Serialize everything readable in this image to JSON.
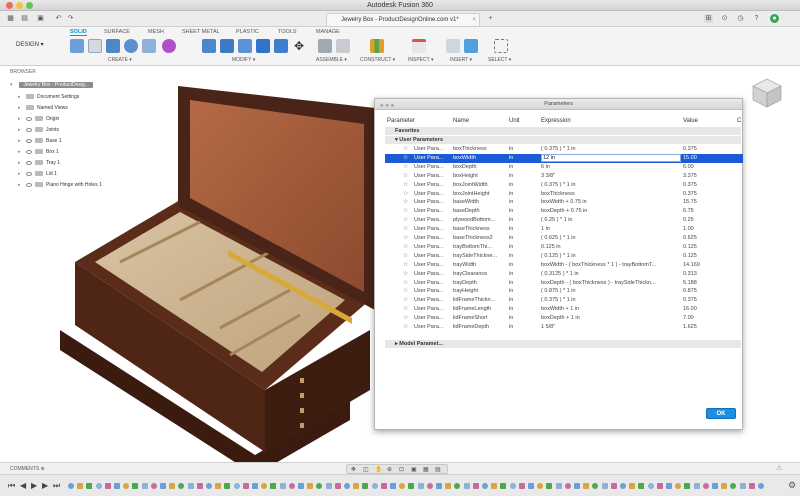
{
  "window": {
    "title": "Autodesk Fusion 360",
    "document_tab": "Jewelry Box - ProductDesignOnline.com v1*"
  },
  "ribbon": {
    "workspace": "DESIGN",
    "tabs": [
      "SOLID",
      "SURFACE",
      "MESH",
      "SHEET METAL",
      "PLASTIC",
      "TOOLS",
      "MANAGE"
    ],
    "active_tab": "SOLID",
    "groups": [
      "CREATE",
      "MODIFY",
      "ASSEMBLE",
      "CONSTRUCT",
      "INSPECT",
      "INSERT",
      "SELECT"
    ]
  },
  "browser": {
    "header": "BROWSER",
    "root": "Jewelry Box - ProductDesig...",
    "items": [
      "Document Settings",
      "Named Views",
      "Origin",
      "Joints",
      "Base 1",
      "Box 1",
      "Tray 1",
      "Lid 1",
      "Piano Hinge with Holes 1"
    ]
  },
  "dialog": {
    "title": "Parameters",
    "columns": [
      "Parameter",
      "Name",
      "Unit",
      "Expression",
      "Value",
      "C"
    ],
    "section_favorites": "Favorites",
    "section_user": "User Parameters",
    "section_model": "Model Paramet...",
    "param_type": "User Para...",
    "rows": [
      {
        "name": "boxThickness",
        "unit": "in",
        "expression": "( 0.375 ) * 1 in",
        "value": "0.375"
      },
      {
        "name": "boxWidth",
        "unit": "in",
        "expression": "12 in",
        "value": "15.00",
        "selected": true
      },
      {
        "name": "boxDepth",
        "unit": "in",
        "expression": "6 in",
        "value": "6.00"
      },
      {
        "name": "boxHeight",
        "unit": "in",
        "expression": "3 3/8\"",
        "value": "3.375"
      },
      {
        "name": "boxJointWidth",
        "unit": "in",
        "expression": "( 0.375 ) * 1 in",
        "value": "0.375"
      },
      {
        "name": "boxJointHeight",
        "unit": "in",
        "expression": "boxThickness",
        "value": "0.375"
      },
      {
        "name": "baseWidth",
        "unit": "in",
        "expression": "boxWidth + 0.75 in",
        "value": "15.75"
      },
      {
        "name": "baseDepth",
        "unit": "in",
        "expression": "boxDepth + 0.75 in",
        "value": "6.75"
      },
      {
        "name": "plywoodBottom...",
        "unit": "in",
        "expression": "( 0.25 ) * 1 in",
        "value": "0.25"
      },
      {
        "name": "baseThickness",
        "unit": "in",
        "expression": "1 in",
        "value": "1.00"
      },
      {
        "name": "baseThickness2",
        "unit": "in",
        "expression": "( 0.625 ) * 1 in",
        "value": "0.625"
      },
      {
        "name": "trayBottomThi...",
        "unit": "in",
        "expression": "0.125 in",
        "value": "0.125"
      },
      {
        "name": "traySideThickne...",
        "unit": "in",
        "expression": "( 0.125 ) * 1 in",
        "value": "0.125"
      },
      {
        "name": "trayWidth",
        "unit": "in",
        "expression": "boxWidth - ( boxThickness * 1 ) - trayBottomT...",
        "value": "14.169"
      },
      {
        "name": "trayClearance",
        "unit": "in",
        "expression": "( 0.3125 ) * 1 in",
        "value": "0.313"
      },
      {
        "name": "trayDepth",
        "unit": "in",
        "expression": "boxDepth - ( boxThickness ) - traySideThickn...",
        "value": "5.188"
      },
      {
        "name": "trayHeight",
        "unit": "in",
        "expression": "( 0.875 ) * 1 in",
        "value": "0.875"
      },
      {
        "name": "lidFrameThickn...",
        "unit": "in",
        "expression": "( 0.375 ) * 1 in",
        "value": "0.375"
      },
      {
        "name": "lidFrameLength",
        "unit": "in",
        "expression": "boxWidth + 1 in",
        "value": "16.00"
      },
      {
        "name": "lidFrameShort",
        "unit": "in",
        "expression": "boxDepth + 1 in",
        "value": "7.00"
      },
      {
        "name": "lidFrameDepth",
        "unit": "in",
        "expression": "1 5/8\"",
        "value": "1.625"
      }
    ],
    "ok_label": "OK"
  },
  "bottom": {
    "comments_label": "COMMENTS"
  },
  "colors": {
    "accent": "#0696d7",
    "selection": "#1c5bd8",
    "ok_button": "#1d8ee6",
    "wood_dark": "#4a2418",
    "wood_light": "#c89f72"
  }
}
